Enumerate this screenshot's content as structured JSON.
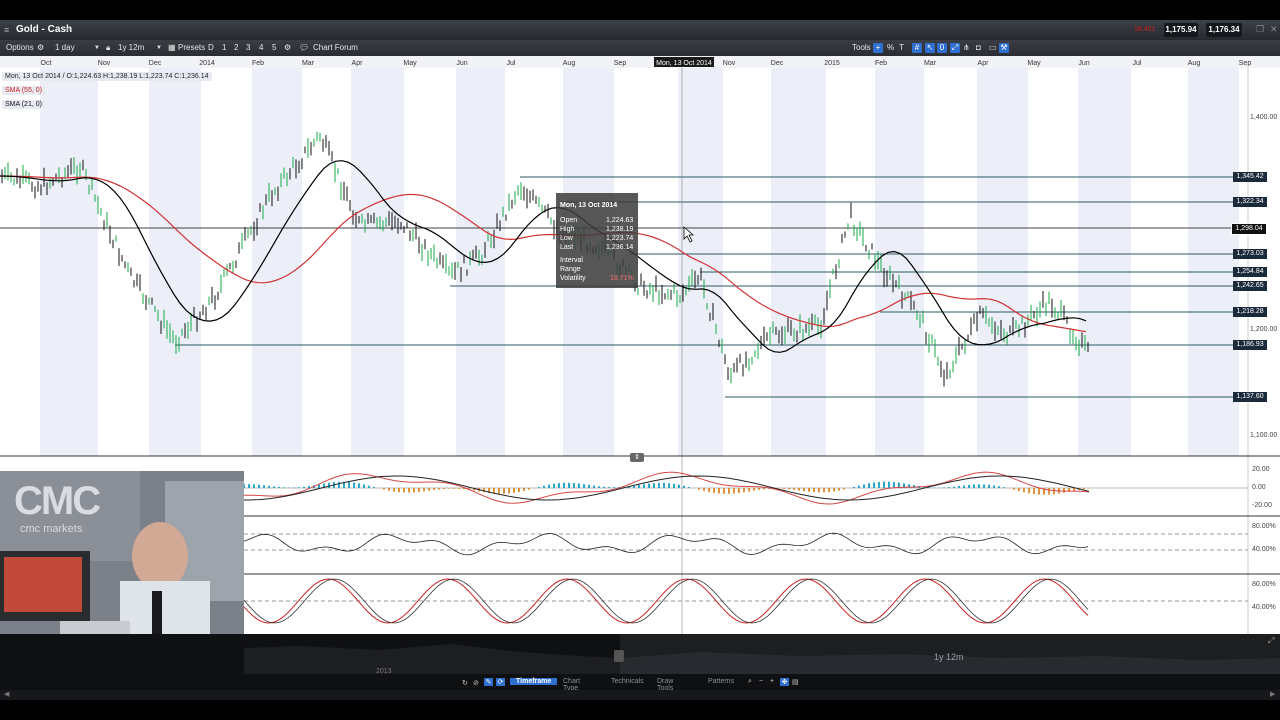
{
  "header": {
    "title": "Gold - Cash",
    "sell_price": "1,175.94",
    "buy_price": "1,176.34",
    "flag_text": "18.401"
  },
  "toolbar": {
    "options_label": "Options",
    "interval": "1 day",
    "range": "1y 12m",
    "presets_label": "Presets",
    "preset_items": [
      "D",
      "1",
      "2",
      "3",
      "4",
      "5"
    ],
    "chart_forum_label": "Chart Forum",
    "tools_label": "Tools"
  },
  "months_top": [
    "Oct",
    "Nov",
    "Dec",
    "2014",
    "Feb",
    "Mar",
    "Apr",
    "May",
    "Jun",
    "Jul",
    "Aug",
    "Sep",
    "Mon, 13 Oct 2014",
    "Nov",
    "Dec",
    "2015",
    "Feb",
    "Mar",
    "Apr",
    "May",
    "Jun",
    "Jul",
    "Aug",
    "Sep"
  ],
  "ohlc_line": "Mon, 13 Oct 2014 / O:1,224.63  H:1,238.19  L:1,223.74  C:1,236.14",
  "indicators": [
    "SMA (55, 0)",
    "SMA (21, 0)"
  ],
  "price_axis": [
    "1,400.00",
    "1,200.00",
    "1,100.00"
  ],
  "levels": [
    {
      "label": "1,345.42",
      "color": "#1f3b52"
    },
    {
      "label": "1,322.34",
      "color": "#1f3b52"
    },
    {
      "label": "1,298.04",
      "color": "#111111"
    },
    {
      "label": "1,273.03",
      "color": "#1f3b52"
    },
    {
      "label": "1,254.84",
      "color": "#1f3b52"
    },
    {
      "label": "1,242.65",
      "color": "#1f3b52"
    },
    {
      "label": "1,218.28",
      "color": "#1f3b52"
    },
    {
      "label": "1,186.93",
      "color": "#1f3b52"
    },
    {
      "label": "1,137.60",
      "color": "#1f3b52"
    }
  ],
  "tooltip": {
    "date": "Mon, 13 Oct 2014",
    "rows": [
      {
        "k": "Open",
        "v": "1,224.63"
      },
      {
        "k": "High",
        "v": "1,238.19"
      },
      {
        "k": "Low",
        "v": "1,223.74"
      },
      {
        "k": "Last",
        "v": "1,236.14"
      },
      {
        "k": "Interval",
        "v": ""
      },
      {
        "k": "Range",
        "v": ""
      },
      {
        "k": "Volatility",
        "v": "18.71%"
      }
    ]
  },
  "macd_axis": [
    "20.00",
    "0.00",
    "-20.00"
  ],
  "osc_axis": [
    "80.00%",
    "40.00%"
  ],
  "stoch_axis": [
    "80.00%",
    "40.00%"
  ],
  "navigator": {
    "year_label": "2013",
    "range_label": "1y 12m"
  },
  "bottom_tabs": [
    "Timeframe",
    "Chart Type",
    "Technicals",
    "Draw Tools",
    "Patterns"
  ],
  "webcam_sign": "CMC",
  "webcam_sub": "cmc markets",
  "colors": {
    "accent": "#2f6fd0",
    "sma_long": "#d23232",
    "sma_short": "#000000",
    "up": "#1aa84a",
    "down": "#111111"
  }
}
